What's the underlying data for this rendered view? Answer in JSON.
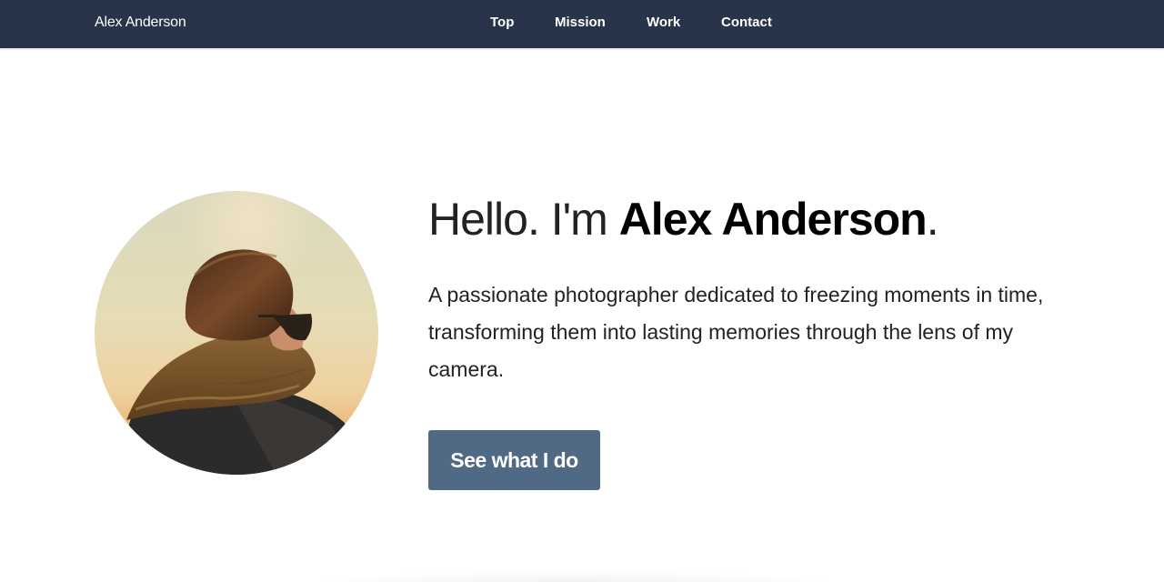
{
  "nav": {
    "brand": "Alex Anderson",
    "links": [
      {
        "label": "Top"
      },
      {
        "label": "Mission"
      },
      {
        "label": "Work"
      },
      {
        "label": "Contact"
      }
    ]
  },
  "hero": {
    "greeting": "Hello. I'm ",
    "name": "Alex Anderson",
    "punctuation": ".",
    "description": "A passionate photographer dedicated to freezing moments in time, transforming them into lasting memories through the lens of my camera.",
    "cta_label": "See what I do"
  },
  "colors": {
    "navbar": "#273449",
    "button": "#506a85",
    "text": "#222222"
  }
}
